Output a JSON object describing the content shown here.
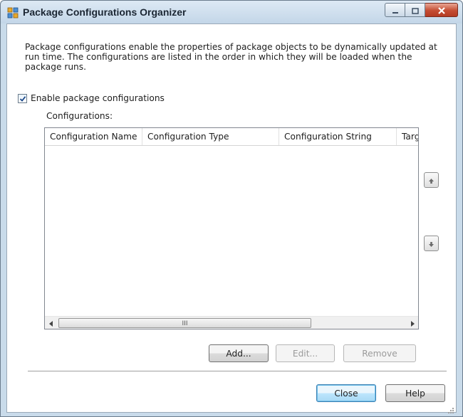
{
  "window": {
    "title": "Package Configurations Organizer"
  },
  "description": "Package configurations enable the properties of package objects to be dynamically updated at run time. The configurations are listed in the order in which they will be loaded when the package runs.",
  "enable_checkbox": {
    "label": "Enable package configurations",
    "checked": true
  },
  "configurations": {
    "label": "Configurations:",
    "columns": [
      "Configuration Name",
      "Configuration Type",
      "Configuration String",
      "Targ"
    ],
    "rows": []
  },
  "scrollbar": {
    "grip": "III"
  },
  "buttons": {
    "add": "Add...",
    "edit": "Edit...",
    "remove": "Remove",
    "close": "Close",
    "help": "Help"
  },
  "icons": {
    "app": "package-configuration-icon",
    "move_up": "arrow-up-icon",
    "move_down": "arrow-down-icon"
  },
  "colors": {
    "title_bar": "#c3d6e8",
    "close_caption": "#c44c32",
    "default_button": "#bee6fd"
  }
}
